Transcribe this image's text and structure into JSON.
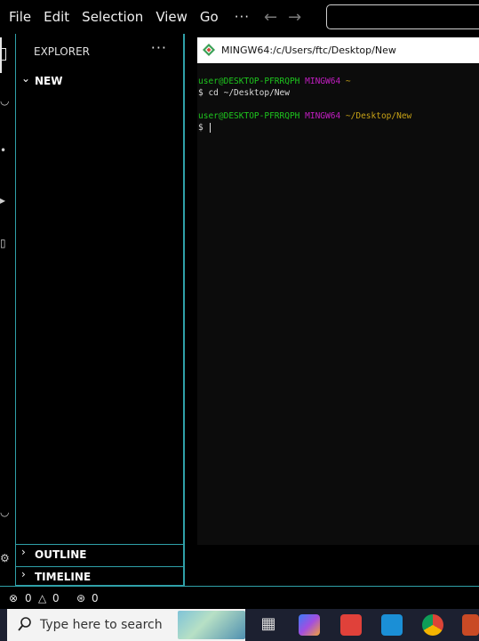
{
  "menubar": {
    "items": [
      "File",
      "Edit",
      "Selection",
      "View",
      "Go"
    ],
    "more": "···",
    "back_icon": "arrow-left-icon",
    "forward_icon": "arrow-right-icon"
  },
  "sidebar": {
    "header": "EXPLORER",
    "more": "···",
    "folder": "NEW",
    "outline": "OUTLINE",
    "timeline": "TIMELINE"
  },
  "terminal": {
    "title": "MINGW64:/c/Users/ftc/Desktop/New",
    "line1_user": "user@DESKTOP-PFRRQPH",
    "line1_env": "MINGW64",
    "line1_path": "~",
    "line2": "$ cd ~/Desktop/New",
    "line3_user": "user@DESKTOP-PFRRQPH",
    "line3_env": "MINGW64",
    "line3_path": "~/Desktop/New",
    "line4": "$ "
  },
  "statusbar": {
    "errors": "0",
    "warnings": "0",
    "ports": "0"
  },
  "taskbar": {
    "search_placeholder": "Type here to search"
  },
  "colors": {
    "accent": "#2fa0a8",
    "user_green": "#1ec61e",
    "mingw_magenta": "#c21ec2",
    "path_yellow": "#c7a216"
  }
}
